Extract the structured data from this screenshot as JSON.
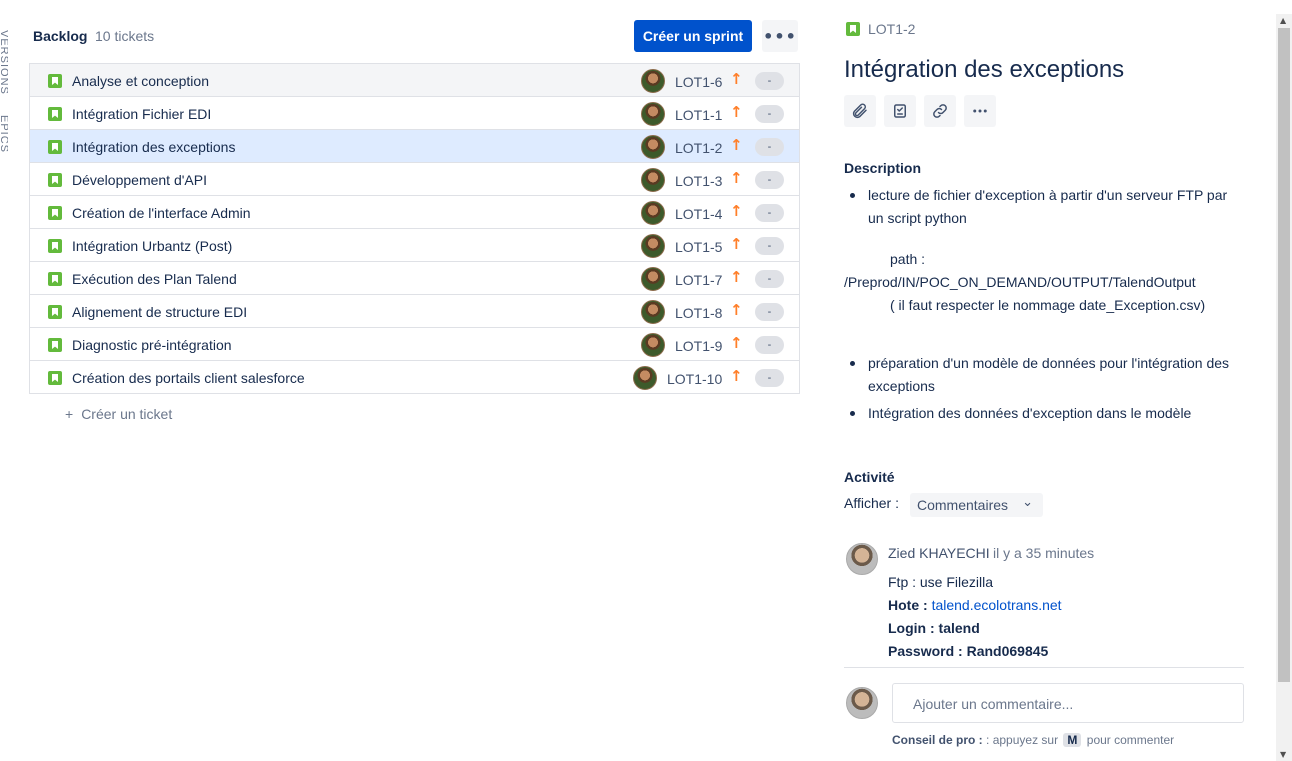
{
  "side_labels": {
    "versions": "VERSIONS",
    "epics": "EPICS"
  },
  "backlog": {
    "title": "Backlog",
    "count": "10 tickets",
    "create_sprint_label": "Créer un sprint",
    "more_label": "•••",
    "create_ticket_label": "Créer un ticket",
    "issues": [
      {
        "summary": "Analyse et conception",
        "key": "LOT1-6",
        "estimate": "-"
      },
      {
        "summary": "Intégration Fichier EDI",
        "key": "LOT1-1",
        "estimate": "-"
      },
      {
        "summary": "Intégration des exceptions",
        "key": "LOT1-2",
        "estimate": "-"
      },
      {
        "summary": "Développement d'API",
        "key": "LOT1-3",
        "estimate": "-"
      },
      {
        "summary": "Création de l'interface Admin",
        "key": "LOT1-4",
        "estimate": "-"
      },
      {
        "summary": "Intégration Urbantz (Post)",
        "key": "LOT1-5",
        "estimate": "-"
      },
      {
        "summary": "Exécution des Plan Talend",
        "key": "LOT1-7",
        "estimate": "-"
      },
      {
        "summary": "Alignement de structure EDI",
        "key": "LOT1-8",
        "estimate": "-"
      },
      {
        "summary": "Diagnostic pré-intégration",
        "key": "LOT1-9",
        "estimate": "-"
      },
      {
        "summary": "Création des portails client salesforce",
        "key": "LOT1-10",
        "estimate": "-"
      }
    ],
    "priority_icon": "arrow-up-icon",
    "issue_type_icon": "story-icon"
  },
  "detail": {
    "key": "LOT1-2",
    "title": "Intégration des exceptions",
    "description_label": "Description",
    "description": {
      "bullet1": "lecture de fichier d'exception  à partir d'un serveur FTP  par un script python",
      "path_label": "path :",
      "path_value": "/Preprod/IN/POC_ON_DEMAND/OUTPUT/TalendOutput",
      "path_note": "( il faut respecter le nommage date_Exception.csv)",
      "bullet2": "préparation d'un modèle de données pour l'intégration des exceptions",
      "bullet3": "Intégration des données d'exception dans le modèle"
    },
    "activity_label": "Activité",
    "show_label": "Afficher :",
    "show_value": "Commentaires",
    "comment": {
      "author": "Zied KHAYECHI",
      "time": "il y a 35 minutes",
      "line1": "Ftp : use Filezilla",
      "host_label": "Hote :",
      "host_value": "talend.ecolotrans.net",
      "login_text": "Login : talend",
      "password_text": "Password : Rand069845"
    },
    "comment_placeholder": "Ajouter un commentaire...",
    "tip_label": "Conseil de pro :",
    "tip_before": ": appuyez sur",
    "tip_key": "M",
    "tip_after": "pour commenter"
  },
  "colors": {
    "primary": "#0052cc",
    "story_green": "#63ba3c",
    "priority_orange": "#ff7f2a",
    "selected_row": "#deebff"
  }
}
